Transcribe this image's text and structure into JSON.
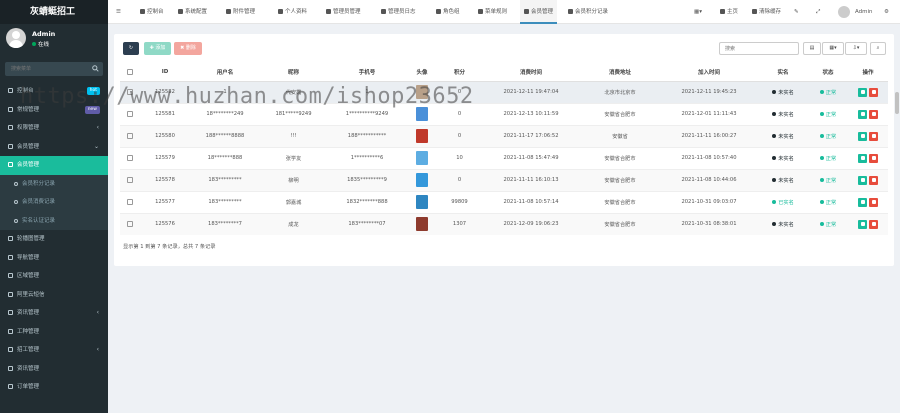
{
  "app": {
    "brand": "灰蜻蜓招工"
  },
  "user": {
    "name": "Admin",
    "status": "在线"
  },
  "sidebar": {
    "search_placeholder": "搜索菜单",
    "items": [
      {
        "label": "控制台",
        "badge": "hot",
        "badge_color": "#00c0ef",
        "type": "top"
      },
      {
        "label": "常规管理",
        "badge": "new",
        "badge_color": "#605ca8",
        "type": "top"
      },
      {
        "label": "权限管理",
        "chevron": "‹",
        "type": "top"
      },
      {
        "label": "会员管理",
        "chevron": "⌄",
        "type": "top"
      },
      {
        "label": "会员管理",
        "type": "sub-active"
      },
      {
        "label": "会员积分记录",
        "type": "sub"
      },
      {
        "label": "会员消费记录",
        "type": "sub"
      },
      {
        "label": "实名认证记录",
        "type": "sub"
      },
      {
        "label": "轮播图管理",
        "type": "top"
      },
      {
        "label": "导航管理",
        "type": "top"
      },
      {
        "label": "区域管理",
        "type": "top"
      },
      {
        "label": "阿里云短信",
        "type": "top"
      },
      {
        "label": "资讯管理",
        "chevron": "‹",
        "type": "top"
      },
      {
        "label": "工种管理",
        "type": "top"
      },
      {
        "label": "招工管理",
        "chevron": "‹",
        "type": "top"
      },
      {
        "label": "资讯管理",
        "type": "top"
      },
      {
        "label": "订单管理",
        "type": "top"
      }
    ]
  },
  "topbar": {
    "tabs": [
      {
        "label": "控制台"
      },
      {
        "label": "系统配置"
      },
      {
        "label": "附件管理"
      },
      {
        "label": "个人资料"
      },
      {
        "label": "管理员管理"
      },
      {
        "label": "管理员日志"
      },
      {
        "label": "角色组"
      },
      {
        "label": "菜单规则"
      },
      {
        "label": "会员管理",
        "active": true
      },
      {
        "label": "会员积分记录"
      }
    ],
    "home": "主页",
    "clear_cache": "清除缓存",
    "admin": "Admin"
  },
  "toolbar": {
    "add_label": "添加",
    "delete_label": "删除",
    "search_placeholder": "搜索"
  },
  "table": {
    "columns": [
      "ID",
      "用户名",
      "昵称",
      "手机号",
      "头像",
      "积分",
      "消费时间",
      "消费地址",
      "加入时间",
      "实名",
      "状态",
      "操作"
    ],
    "rows": [
      {
        "id": "125582",
        "username": "1",
        "nickname": "代安霞",
        "phone": "1",
        "avatar": "#b8a089",
        "score": "0",
        "time": "2021-12-11 19:47:04",
        "addr": "北京市北京市",
        "join": "2021-12-11 19:45:23",
        "real": "未实名",
        "real_color": "#222d32",
        "status": "正常"
      },
      {
        "id": "125581",
        "username": "18********249",
        "nickname": "181*****9249",
        "phone": "1**********9249",
        "avatar": "#4a90d9",
        "score": "0",
        "time": "2021-12-13 10:11:59",
        "addr": "安徽省合肥市",
        "join": "2021-12-01 11:11:43",
        "real": "未实名",
        "real_color": "#222d32",
        "status": "正常"
      },
      {
        "id": "125580",
        "username": "188******8888",
        "nickname": "!!!",
        "phone": "188***********",
        "avatar": "#c0392b",
        "score": "0",
        "time": "2021-11-17 17:06:52",
        "addr": "安徽省",
        "join": "2021-11-11 16:00:27",
        "real": "未实名",
        "real_color": "#222d32",
        "status": "正常"
      },
      {
        "id": "125579",
        "username": "18*******888",
        "nickname": "张学友",
        "phone": "1**********6",
        "avatar": "#5dade2",
        "score": "10",
        "time": "2021-11-08 15:47:49",
        "addr": "安徽省合肥市",
        "join": "2021-11-08 10:57:40",
        "real": "未实名",
        "real_color": "#222d32",
        "status": "正常"
      },
      {
        "id": "125578",
        "username": "183*********",
        "nickname": "柳明",
        "phone": "1835*********9",
        "avatar": "#3498db",
        "score": "0",
        "time": "2021-11-11 16:10:13",
        "addr": "安徽省合肥市",
        "join": "2021-11-08 10:44:06",
        "real": "未实名",
        "real_color": "#222d32",
        "status": "正常"
      },
      {
        "id": "125577",
        "username": "183*********",
        "nickname": "郭嘉城",
        "phone": "1832*******888",
        "avatar": "#2e86c1",
        "score": "99809",
        "time": "2021-11-08 10:57:14",
        "addr": "安徽省合肥市",
        "join": "2021-10-31 09:03:07",
        "real": "已实名",
        "real_color": "#18bc9c",
        "status": "正常"
      },
      {
        "id": "125576",
        "username": "183********7",
        "nickname": "成龙",
        "phone": "183********07",
        "avatar": "#8e3b2e",
        "score": "1307",
        "time": "2021-12-09 19:06:23",
        "addr": "安徽省合肥市",
        "join": "2021-10-31 08:38:01",
        "real": "未实名",
        "real_color": "#222d32",
        "status": "正常"
      }
    ],
    "footer": "显示第 1 到第 7 条记录，总共 7 条记录"
  },
  "watermark": "https://www.huzhan.com/ishop23652",
  "colors": {
    "status_ok": "#18bc9c",
    "sidebar_bg": "#222d32",
    "active": "#1abc9c"
  }
}
